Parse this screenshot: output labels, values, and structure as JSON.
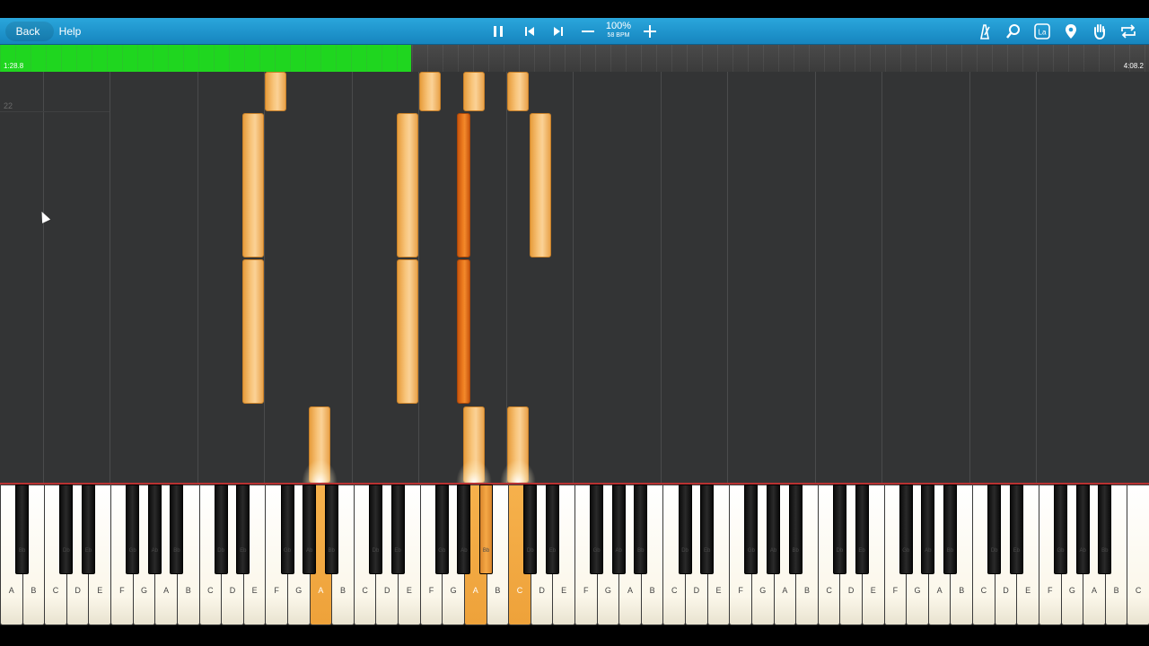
{
  "toolbar": {
    "back_label": "Back",
    "help_label": "Help",
    "tempo_percent": "100%",
    "tempo_bpm": "58 BPM",
    "icons": [
      "pause-icon",
      "skip-back-icon",
      "skip-forward-icon",
      "minus-icon",
      "plus-icon",
      "metronome-icon",
      "zoom-icon",
      "label-icon",
      "marker-icon",
      "hand-icon",
      "loop-icon"
    ],
    "label_icon_text": "La"
  },
  "timeline": {
    "current_time": "1:28.8",
    "total_time": "4:08.2",
    "progress": 0.358
  },
  "roll": {
    "measure_number": "22"
  },
  "keyboard": {
    "white_keys": [
      "A",
      "B",
      "C",
      "D",
      "E",
      "F",
      "G",
      "A",
      "B",
      "C",
      "D",
      "E",
      "F",
      "G",
      "A",
      "B",
      "C",
      "D",
      "E",
      "F",
      "G",
      "A",
      "B",
      "C",
      "D",
      "E",
      "F",
      "G",
      "A",
      "B",
      "C",
      "D",
      "E",
      "F",
      "G",
      "A",
      "B",
      "C",
      "D",
      "E",
      "F",
      "G",
      "A",
      "B",
      "C",
      "D",
      "E",
      "F",
      "G",
      "A",
      "B",
      "C"
    ],
    "lit_white_indices": [
      14,
      21,
      23
    ],
    "black_key_labels": [
      "Bb",
      "Db",
      "Eb",
      "Gb",
      "Ab",
      "Bb",
      "Db",
      "Eb",
      "Gb",
      "Ab",
      "Bb",
      "Db",
      "Eb",
      "Gb",
      "Ab",
      "Bb",
      "Db",
      "Eb",
      "Gb",
      "Ab",
      "Bb",
      "Db",
      "Eb",
      "Gb",
      "Ab",
      "Bb",
      "Db",
      "Eb",
      "Gb",
      "Ab",
      "Bb",
      "Db",
      "Eb",
      "Gb",
      "Ab",
      "Bb"
    ]
  },
  "colors": {
    "toolbar": "#1f97d0",
    "progress": "#1fd61f",
    "note_light": "#f8c57c",
    "note_dark": "#ee7e20",
    "roll_background": "#333435"
  }
}
